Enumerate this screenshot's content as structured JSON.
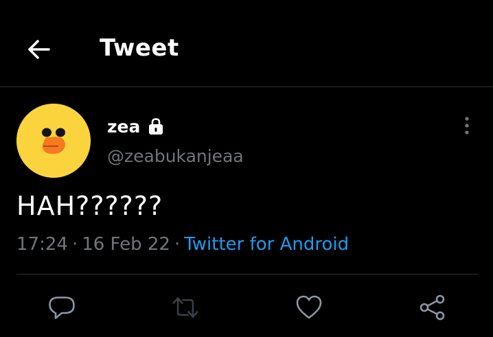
{
  "header": {
    "title": "Tweet",
    "back_icon": "arrow-left-icon"
  },
  "tweet": {
    "display_name": "zea",
    "protected_icon": "lock-icon",
    "handle": "@zeabukanjeaa",
    "text": "HAH??????",
    "time": "17:24",
    "date": "16 Feb 22",
    "separator": "·",
    "source": "Twitter for Android",
    "more_icon": "more-vertical-icon"
  },
  "actions": [
    {
      "name": "reply",
      "icon": "reply-icon"
    },
    {
      "name": "retweet",
      "icon": "retweet-icon"
    },
    {
      "name": "like",
      "icon": "heart-icon"
    },
    {
      "name": "share",
      "icon": "share-icon"
    }
  ],
  "colors": {
    "background": "#000000",
    "text": "#ffffff",
    "secondary_text": "#71767b",
    "link": "#1d9bf0",
    "divider": "#2f3336",
    "avatar_bg": "#fbd33d",
    "avatar_beak": "#f57a21",
    "action_icon": "#8b98a5"
  }
}
